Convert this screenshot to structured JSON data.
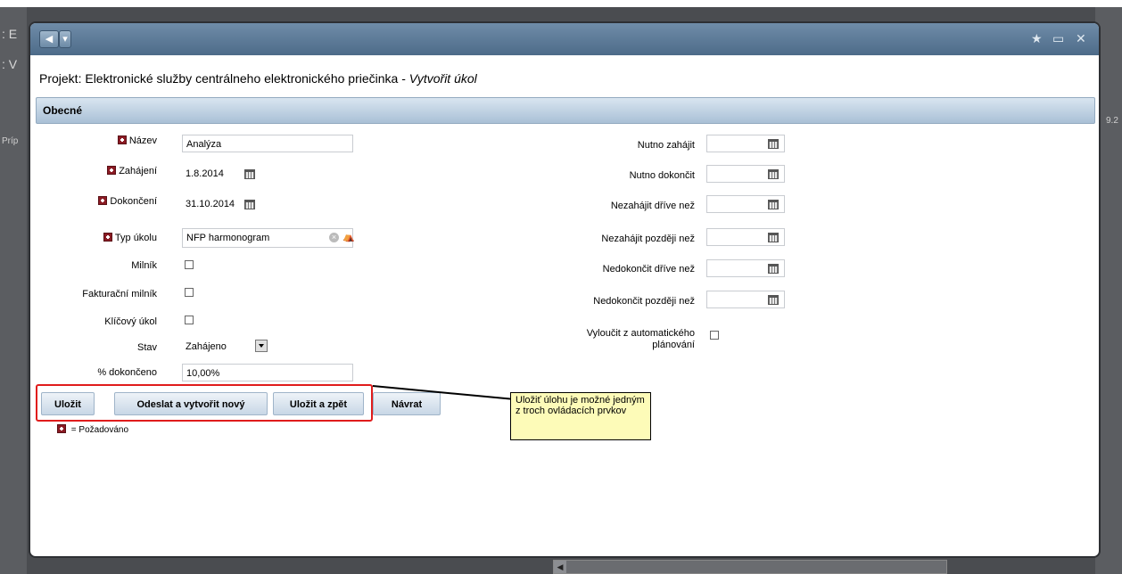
{
  "background": {
    "left_chars": [
      ": E",
      ": V",
      "Príp"
    ],
    "right_chars": [
      "9.2"
    ]
  },
  "window": {
    "title_buttons": [
      "◀",
      "▾"
    ],
    "controls": [
      "★",
      "▭",
      "✕"
    ]
  },
  "page": {
    "title_prefix": "Projekt: Elektronické služby centrálneho elektronického priečinka - ",
    "title_action": "Vytvořit úkol",
    "section": "Obecné"
  },
  "form_left": {
    "nazev_label": "Název",
    "nazev_value": "Analýza",
    "zahajeni_label": "Zahájení",
    "zahajeni_value": "1.8.2014",
    "dokonceni_label": "Dokončení",
    "dokonceni_value": "31.10.2014",
    "typ_label": "Typ úkolu",
    "typ_value": "NFP harmonogram",
    "milnik_label": "Milník",
    "fakt_milnik_label": "Fakturační milník",
    "klicovy_label": "Klíčový úkol",
    "stav_label": "Stav",
    "stav_value": "Zahájeno",
    "dokonceno_label": "% dokončeno",
    "dokonceno_value": "10,00%"
  },
  "form_right": {
    "nutno_zahajit": "Nutno zahájit",
    "nutno_dokoncit": "Nutno dokončit",
    "nezahajit_drive": "Nezahájit dříve než",
    "nezahajit_pozdeji": "Nezahájit později než",
    "nedokoncit_drive": "Nedokončit dříve než",
    "nedokoncit_pozdeji": "Nedokončit později než",
    "vyloucit_line1": "Vyloučit z automatického",
    "vyloucit_line2": "plánování"
  },
  "buttons": {
    "ulozit": "Uložit",
    "odeslat": "Odeslat a vytvořit nový",
    "ulozit_zpet": "Uložit a zpět",
    "navrat": "Návrat"
  },
  "callout": {
    "text": "Uložiť úlohu je možné jedným z troch ovládacích prvkov"
  },
  "legend": {
    "text": "= Požadováno"
  },
  "colors": {
    "highlight": "#e01c1c",
    "callout_bg": "#fdfbb8",
    "required_marker": "#8b1b24"
  }
}
